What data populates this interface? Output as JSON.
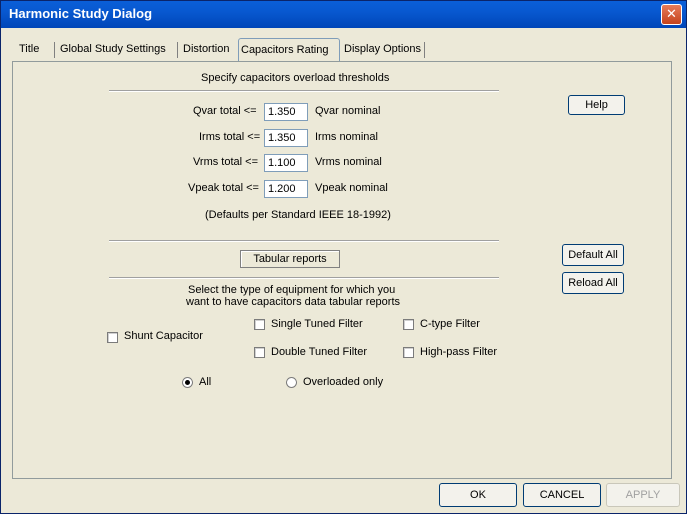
{
  "window": {
    "title": "Harmonic Study Dialog",
    "close_glyph": "✕"
  },
  "tabs": [
    {
      "label": "Title"
    },
    {
      "label": "Global Study Settings"
    },
    {
      "label": "Distortion"
    },
    {
      "label": "Capacitors Rating"
    },
    {
      "label": "Display Options"
    }
  ],
  "active_tab": "Capacitors Rating",
  "overload": {
    "heading": "Specify capacitors overload thresholds",
    "rows": [
      {
        "label": "Qvar total <=",
        "value": "1.350",
        "unit": "Qvar nominal"
      },
      {
        "label": "Irms total <=",
        "value": "1.350",
        "unit": "Irms nominal"
      },
      {
        "label": "Vrms total <=",
        "value": "1.100",
        "unit": "Vrms nominal"
      },
      {
        "label": "Vpeak total <=",
        "value": "1.200",
        "unit": "Vpeak nominal"
      }
    ],
    "defaults_note": "(Defaults per Standard IEEE 18-1992)"
  },
  "buttons": {
    "help": "Help",
    "default_all": "Default All",
    "reload_all": "Reload All",
    "ok": "OK",
    "cancel": "CANCEL",
    "apply": "APPLY"
  },
  "tabular": {
    "label": "Tabular reports",
    "instruction_line1": "Select  the type of equipment for which you",
    "instruction_line2": "want to have capacitors data tabular reports",
    "equipment": {
      "shunt_capacitor": {
        "label": "Shunt Capacitor",
        "checked": false
      },
      "single_tuned_filter": {
        "label": "Single Tuned Filter",
        "checked": false
      },
      "double_tuned_filter": {
        "label": "Double Tuned Filter",
        "checked": false
      },
      "c_type_filter": {
        "label": "C-type Filter",
        "checked": false
      },
      "high_pass_filter": {
        "label": "High-pass Filter",
        "checked": false
      }
    },
    "scope": {
      "all": {
        "label": "All",
        "selected": true
      },
      "overloaded_only": {
        "label": "Overloaded only",
        "selected": false
      }
    }
  }
}
